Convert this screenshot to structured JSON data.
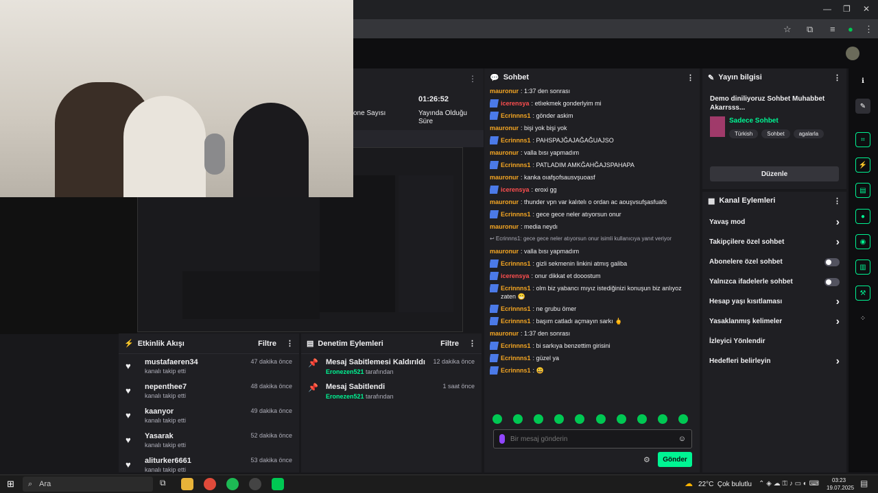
{
  "stats": {
    "viewers_label": "one Sayısı",
    "uptime_value": "01:26:52",
    "uptime_label": "Yayında Olduğu Süre"
  },
  "chat": {
    "title": "Sohbet",
    "messages": [
      {
        "user": "mauronur",
        "text": "1:37 den sonrası",
        "color": "#f5a623",
        "badge": false
      },
      {
        "user": "icerensya",
        "text": "etlıekmek gonderlyim mi",
        "color": "#ff4f4f",
        "badge": true
      },
      {
        "user": "Ecrinnns1",
        "text": "gönder askim",
        "color": "#f5a623",
        "badge": true
      },
      {
        "user": "mauronur",
        "text": "bişi yok bişi yok",
        "color": "#f5a623",
        "badge": false
      },
      {
        "user": "Ecrinnns1",
        "text": "PAHSPAJĞAJAĞAĞUAJSO",
        "color": "#f5a623",
        "badge": true
      },
      {
        "user": "mauronur",
        "text": "valla bısı yapmadım",
        "color": "#f5a623",
        "badge": false
      },
      {
        "user": "Ecrinnns1",
        "text": "PATLADIM AMKĞAHĞAJSPAHAPA",
        "color": "#f5a623",
        "badge": true
      },
      {
        "user": "mauronur",
        "text": "kanka oıafşofsausvşuoasf",
        "color": "#f5a623",
        "badge": false
      },
      {
        "user": "icerensya",
        "text": "eroxi gg",
        "color": "#ff4f4f",
        "badge": true
      },
      {
        "user": "mauronur",
        "text": "thunder vpn var kalıtelı o ordan ac aouşvsufşasfuafs",
        "color": "#f5a623",
        "badge": false
      },
      {
        "user": "Ecrinnns1",
        "text": "gece gece neler atıyorsun onur",
        "color": "#f5a623",
        "badge": true
      },
      {
        "user": "mauronur",
        "text": "media neydı",
        "color": "#f5a623",
        "badge": false
      },
      {
        "user": "",
        "text": "↩ Ecrinnns1: gece gece neler atıyorsun onur isimli kullanıcıya yanıt veriyor",
        "color": "#adadb8",
        "badge": false,
        "reply": true
      },
      {
        "user": "mauronur",
        "text": "valla bısı yapmadım",
        "color": "#f5a623",
        "badge": false
      },
      {
        "user": "Ecrinnns1",
        "text": "gizli sekmenin linkini atmış galiba",
        "color": "#f5a623",
        "badge": true
      },
      {
        "user": "icerensya",
        "text": "onur dikkat et dooostum",
        "color": "#ff4f4f",
        "badge": true
      },
      {
        "user": "Ecrinnns1",
        "text": "olm biz yabancı mıyız istediğinizi konuşun biz anlıyoz zaten 😁",
        "color": "#f5a623",
        "badge": true
      },
      {
        "user": "Ecrinnns1",
        "text": "ne grubu ömer",
        "color": "#f5a623",
        "badge": true
      },
      {
        "user": "Ecrinnns1",
        "text": "başım catladı açmayın sarkı 🖕",
        "color": "#f5a623",
        "badge": true
      },
      {
        "user": "mauronur",
        "text": "1:37 den sonrası",
        "color": "#f5a623",
        "badge": false
      },
      {
        "user": "Ecrinnns1",
        "text": "bi sarkıya benzettim girisini",
        "color": "#f5a623",
        "badge": true
      },
      {
        "user": "Ecrinnns1",
        "text": "güzel ya",
        "color": "#f5a623",
        "badge": true
      },
      {
        "user": "Ecrinnns1",
        "text": "😃",
        "color": "#f5a623",
        "badge": true
      }
    ],
    "input_placeholder": "Bir mesaj gönderin",
    "send_label": "Gönder"
  },
  "stream_info": {
    "title": "Yayın bilgisi",
    "stream_title": "Demo diniliyoruz Sohbet Muhabbet Akarrsss...",
    "category": "Sadece Sohbet",
    "tags": [
      "Türkish",
      "Sohbet",
      "agalarla"
    ],
    "edit_label": "Düzenle"
  },
  "channel_actions": {
    "title": "Kanal Eylemleri",
    "items": [
      {
        "label": "Yavaş mod",
        "control": "chevron"
      },
      {
        "label": "Takipçilere özel sohbet",
        "control": "chevron"
      },
      {
        "label": "Abonelere özel sohbet",
        "control": "toggle"
      },
      {
        "label": "Yalnızca ifadelerle sohbet",
        "control": "toggle"
      },
      {
        "label": "Hesap yaşı kısıtlaması",
        "control": "chevron"
      },
      {
        "label": "Yasaklanmış kelimeler",
        "control": "chevron"
      },
      {
        "label": "İzleyici Yönlendir",
        "control": "none"
      },
      {
        "label": "Hedefleri belirleyin",
        "control": "chevron"
      }
    ]
  },
  "activity": {
    "title": "Etkinlik Akışı",
    "filter_label": "Filtre",
    "items": [
      {
        "name": "mustafaeren34",
        "sub": "kanalı takip etti",
        "time": "47 dakika önce"
      },
      {
        "name": "nepenthee7",
        "sub": "kanalı takip etti",
        "time": "48 dakika önce"
      },
      {
        "name": "kaanyor",
        "sub": "kanalı takip etti",
        "time": "49 dakika önce"
      },
      {
        "name": "Yasarak",
        "sub": "kanalı takip etti",
        "time": "52 dakika önce"
      },
      {
        "name": "aliturker6661",
        "sub": "kanalı takip etti",
        "time": "53 dakika önce"
      }
    ]
  },
  "moderation": {
    "title": "Denetim Eylemleri",
    "filter_label": "Filtre",
    "items": [
      {
        "action": "Mesaj Sabitlemesi Kaldırıldı",
        "by": "Eronezen521",
        "by_suffix": "tarafından",
        "time": "12 dakika önce"
      },
      {
        "action": "Mesaj Sabitlendi",
        "by": "Eronezen521",
        "by_suffix": "tarafından",
        "time": "1 saat önce"
      }
    ]
  },
  "taskbar": {
    "search_placeholder": "Ara",
    "weather": "22°C  Çok bulutlu",
    "time": "03:23",
    "date": "19.07.2025"
  },
  "colors": {
    "accent": "#00f593",
    "panel": "#1f1f23",
    "bg": "#18181b"
  }
}
